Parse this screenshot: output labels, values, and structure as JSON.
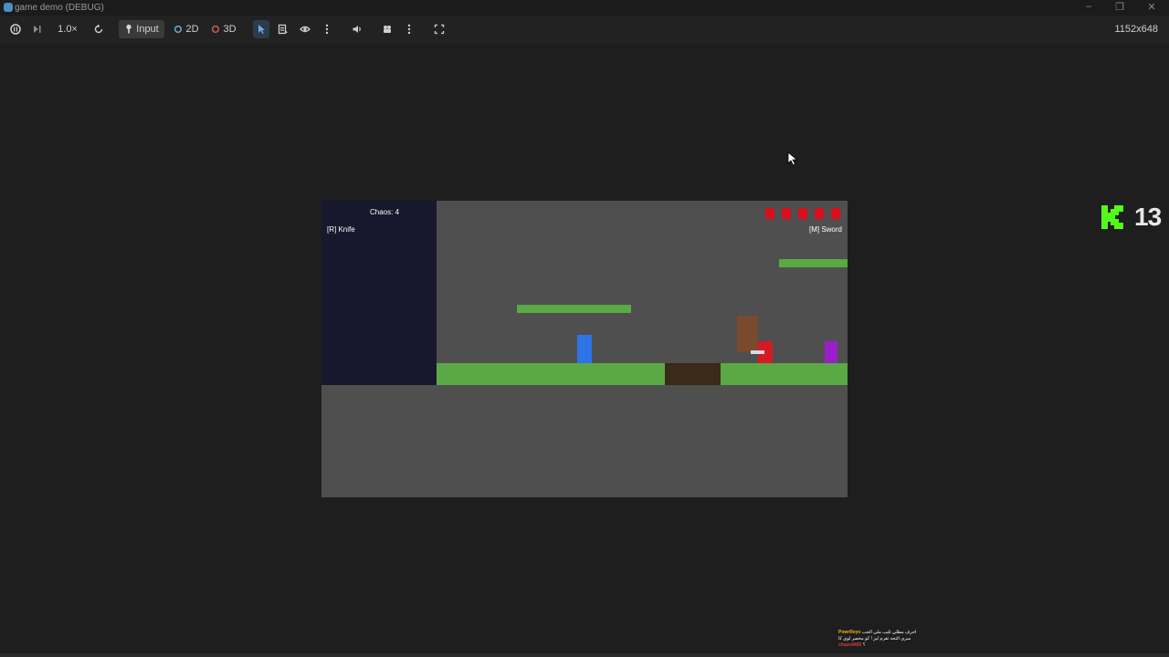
{
  "window": {
    "title": "game demo (DEBUG)"
  },
  "toolbar": {
    "speed": "1.0×",
    "input_label": "Input",
    "mode_2d_label": "2D",
    "mode_3d_label": "3D",
    "resolution": "1152x648"
  },
  "game": {
    "chaos_label": "Chaos: 4",
    "left_weapon": "[R] Knife",
    "right_weapon": "[M] Sword",
    "health": 5
  },
  "overlay": {
    "kick_count": "13",
    "chat": [
      {
        "user": "PowrReyo",
        "message": "احرف مطلي ثليب ملي الحب"
      },
      {
        "user": "",
        "message": "سرى التحه تقرم ليز ! كو مخصر لوي كا"
      },
      {
        "user": "chazed450",
        "message": "؟"
      }
    ]
  },
  "colors": {
    "ground": "#5aa944",
    "pit": "#3a2a18",
    "background": "#4f4f4f",
    "player": "#2f73e8",
    "enemy": "#d41a24",
    "purple_enemy": "#9a1fc8",
    "crate": "#7a4a2e",
    "kick_logo": "#53fc18"
  }
}
